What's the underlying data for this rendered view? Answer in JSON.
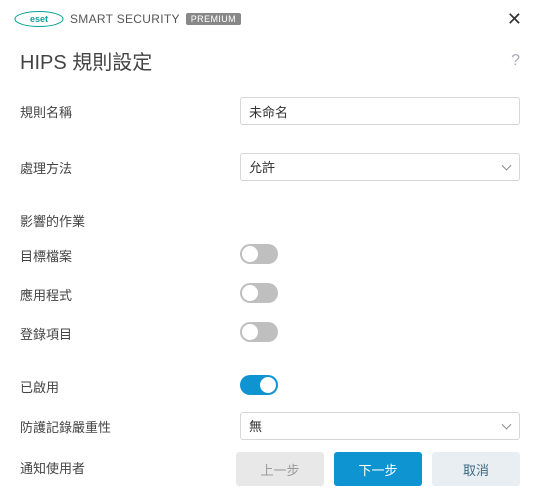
{
  "brand": {
    "logo_text": "eset",
    "product": "SMART SECURITY",
    "edition": "PREMIUM"
  },
  "window": {
    "title": "HIPS 規則設定",
    "help": "?"
  },
  "fields": {
    "rule_name_label": "規則名稱",
    "rule_name_value": "未命名",
    "action_label": "處理方法",
    "action_value": "允許",
    "affects_section": "影響的作業",
    "target_files_label": "目標檔案",
    "applications_label": "應用程式",
    "registry_label": "登錄項目",
    "enabled_label": "已啟用",
    "severity_label": "防護記錄嚴重性",
    "severity_value": "無",
    "notify_label": "通知使用者"
  },
  "toggles": {
    "target_files": false,
    "applications": false,
    "registry": false,
    "enabled": true,
    "notify": false
  },
  "buttons": {
    "back": "上一步",
    "next": "下一步",
    "cancel": "取消"
  }
}
